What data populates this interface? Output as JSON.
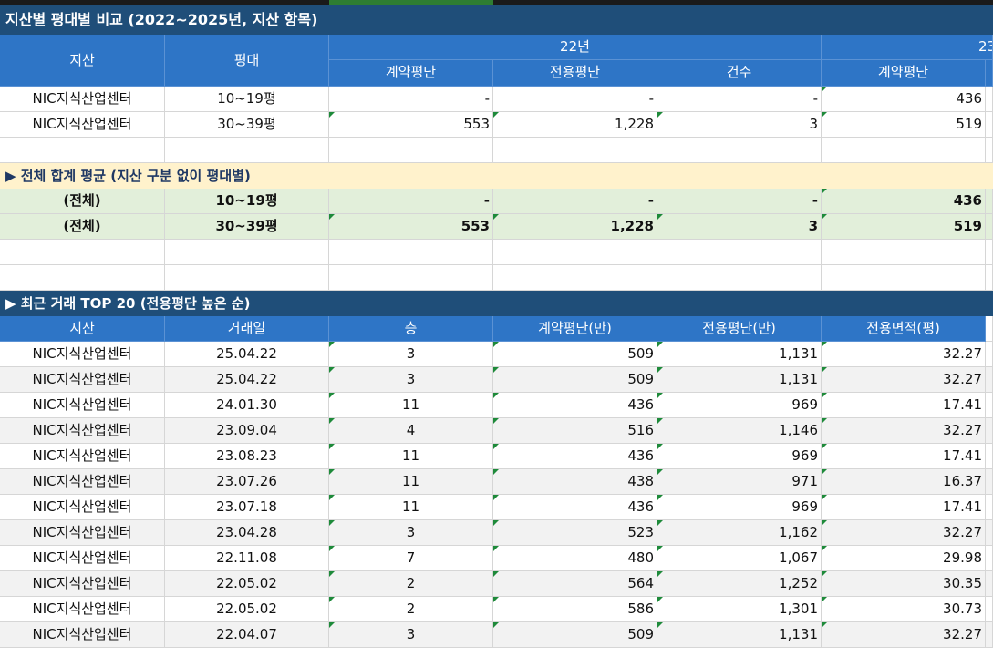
{
  "title": "지산별 평대별 비교 (2022~2025년, 지산 항목)",
  "header": {
    "col_jisan": "지산",
    "col_pyeongdae": "평대",
    "year_22": "22년",
    "year_23": "23",
    "sub": [
      "계약평단",
      "전용평단",
      "건수",
      "계약평단"
    ]
  },
  "compare_rows": [
    {
      "jisan": "NIC지식산업센터",
      "pyeong": "10~19평",
      "v1": "-",
      "v2": "-",
      "v3": "-",
      "v4": "436"
    },
    {
      "jisan": "NIC지식산업센터",
      "pyeong": "30~39평",
      "v1": "553",
      "v2": "1,228",
      "v3": "3",
      "v4": "519"
    }
  ],
  "total_section_title": "▶ 전체 합계 평균 (지산 구분 없이 평대별)",
  "total_rows": [
    {
      "jisan": "(전체)",
      "pyeong": "10~19평",
      "v1": "-",
      "v2": "-",
      "v3": "-",
      "v4": "436"
    },
    {
      "jisan": "(전체)",
      "pyeong": "30~39평",
      "v1": "553",
      "v2": "1,228",
      "v3": "3",
      "v4": "519"
    }
  ],
  "top_section_title": "▶ 최근 거래 TOP 20 (전용평단 높은 순)",
  "top_headers": [
    "지산",
    "거래일",
    "층",
    "계약평단(만)",
    "전용평단(만)",
    "전용면적(평)"
  ],
  "top_rows": [
    {
      "jisan": "NIC지식산업센터",
      "date": "25.04.22",
      "floor": "3",
      "contract": "509",
      "exclusive": "1,131",
      "area": "32.27"
    },
    {
      "jisan": "NIC지식산업센터",
      "date": "25.04.22",
      "floor": "3",
      "contract": "509",
      "exclusive": "1,131",
      "area": "32.27"
    },
    {
      "jisan": "NIC지식산업센터",
      "date": "24.01.30",
      "floor": "11",
      "contract": "436",
      "exclusive": "969",
      "area": "17.41"
    },
    {
      "jisan": "NIC지식산업센터",
      "date": "23.09.04",
      "floor": "4",
      "contract": "516",
      "exclusive": "1,146",
      "area": "32.27"
    },
    {
      "jisan": "NIC지식산업센터",
      "date": "23.08.23",
      "floor": "11",
      "contract": "436",
      "exclusive": "969",
      "area": "17.41"
    },
    {
      "jisan": "NIC지식산업센터",
      "date": "23.07.26",
      "floor": "11",
      "contract": "438",
      "exclusive": "971",
      "area": "16.37"
    },
    {
      "jisan": "NIC지식산업센터",
      "date": "23.07.18",
      "floor": "11",
      "contract": "436",
      "exclusive": "969",
      "area": "17.41"
    },
    {
      "jisan": "NIC지식산업센터",
      "date": "23.04.28",
      "floor": "3",
      "contract": "523",
      "exclusive": "1,162",
      "area": "32.27"
    },
    {
      "jisan": "NIC지식산업센터",
      "date": "22.11.08",
      "floor": "7",
      "contract": "480",
      "exclusive": "1,067",
      "area": "29.98"
    },
    {
      "jisan": "NIC지식산업센터",
      "date": "22.05.02",
      "floor": "2",
      "contract": "564",
      "exclusive": "1,252",
      "area": "30.35"
    },
    {
      "jisan": "NIC지식산업센터",
      "date": "22.05.02",
      "floor": "2",
      "contract": "586",
      "exclusive": "1,301",
      "area": "30.73"
    },
    {
      "jisan": "NIC지식산업센터",
      "date": "22.04.07",
      "floor": "3",
      "contract": "509",
      "exclusive": "1,131",
      "area": "32.27"
    }
  ],
  "colors": {
    "header_blue": "#2e75c6",
    "title_navy": "#1f4e79",
    "total_green": "#e2efda",
    "total_title_yellow": "#fff2cc",
    "corner_marker": "#1e8a3a"
  }
}
